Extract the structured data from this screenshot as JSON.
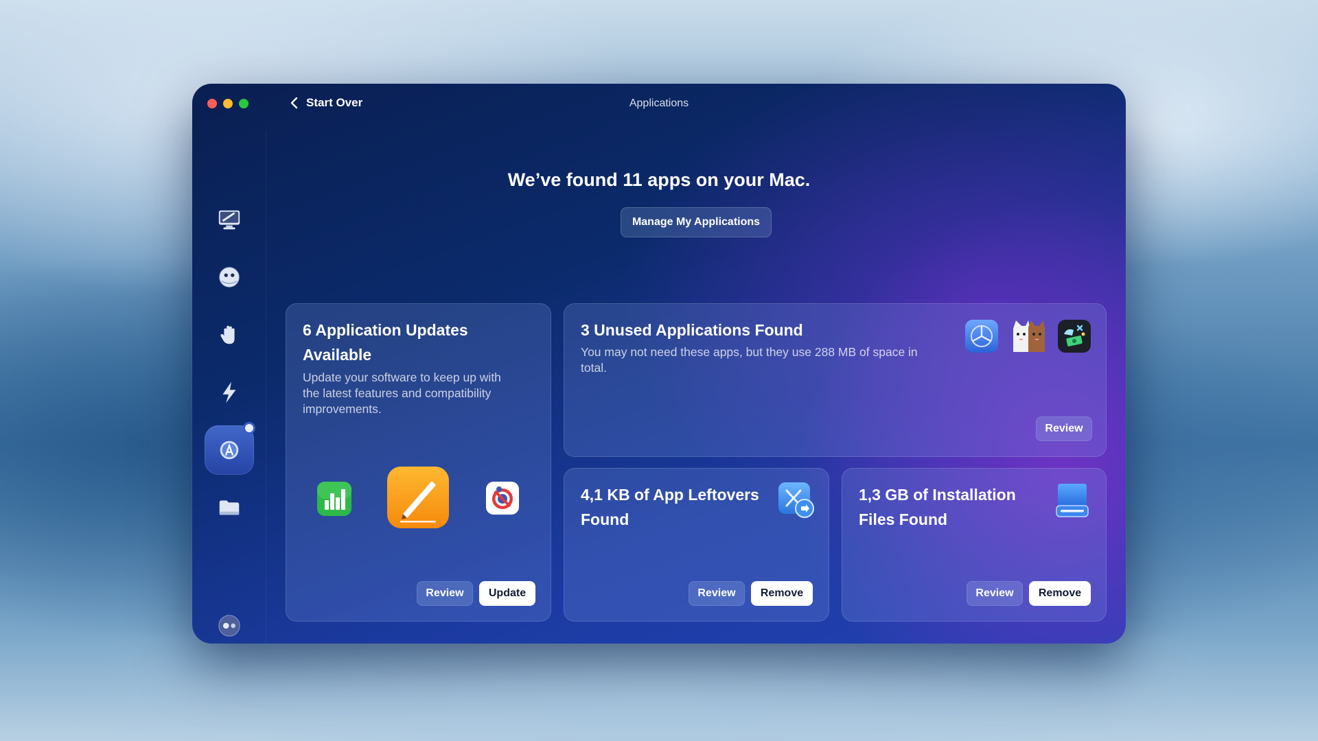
{
  "window": {
    "title": "Applications",
    "back_label": "Start Over"
  },
  "main": {
    "headline": "We’ve found 11 apps on your Mac.",
    "manage_button": "Manage My Applications"
  },
  "cards": {
    "updates": {
      "title_line1": "6 Application Updates",
      "title_line2": "Available",
      "desc_line1": "Update your software to keep up with",
      "desc_line2": "the latest features and compatibility",
      "desc_line3": "improvements.",
      "review": "Review",
      "update": "Update",
      "icons": [
        "numbers-app-icon",
        "pages-app-icon",
        "blocker-app-icon"
      ]
    },
    "unused": {
      "title": "3 Unused Applications Found",
      "desc_line1": "You may not need these apps, but they use 288 MB of space in",
      "desc_line2": "total.",
      "review": "Review",
      "icons": [
        "testflight-app-icon",
        "cats-app-icon",
        "money-app-icon"
      ]
    },
    "leftovers": {
      "title_line1": "4,1 KB of App Leftovers",
      "title_line2": "Found",
      "review": "Review",
      "remove": "Remove",
      "icon": "xcode-leftovers-icon"
    },
    "installation": {
      "title_line1": "1,3 GB of Installation",
      "title_line2": "Files Found",
      "review": "Review",
      "remove": "Remove",
      "icon": "disk-drive-icon"
    }
  },
  "sidebar": {
    "items": [
      "cleanup-icon",
      "protection-icon",
      "privacy-hand-icon",
      "speed-bolt-icon",
      "applications-icon",
      "files-folder-icon"
    ],
    "active": "applications-icon",
    "bottom": "assistant-icon"
  },
  "colors": {
    "close": "#ff5f57",
    "minimize": "#febc2e",
    "maximize": "#28c840",
    "pages_orange": "#f7a21c",
    "numbers_green": "#2fb84a"
  }
}
